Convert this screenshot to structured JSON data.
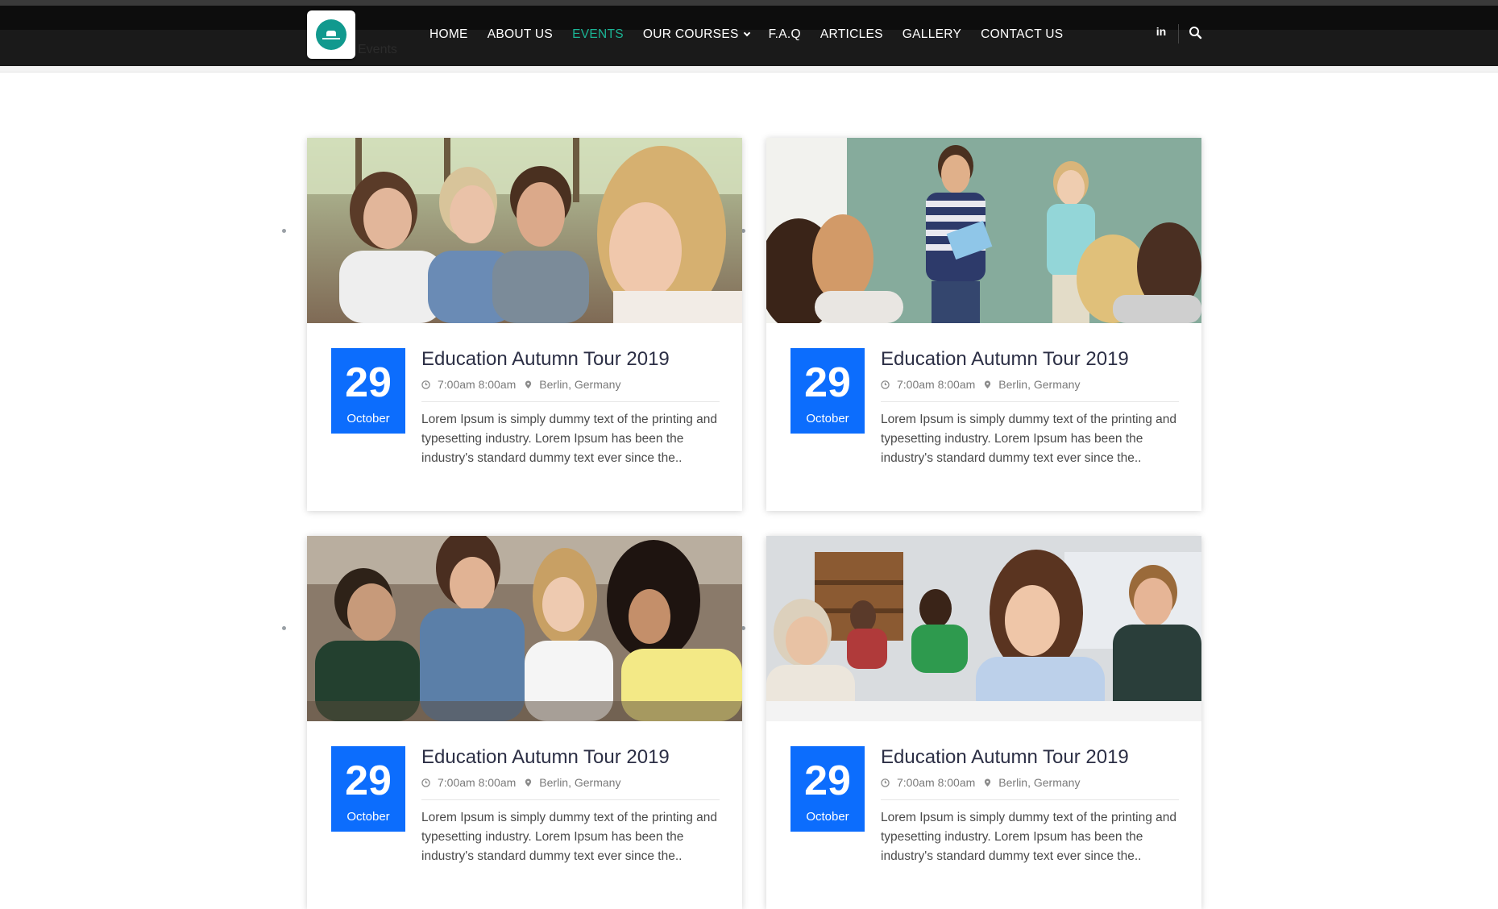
{
  "header": {
    "breadcrumb": "Events",
    "nav": [
      {
        "label": "HOME",
        "active": false
      },
      {
        "label": "ABOUT US",
        "active": false
      },
      {
        "label": "EVENTS",
        "active": true
      },
      {
        "label": "OUR COURSES",
        "active": false,
        "dropdown": true
      },
      {
        "label": "F.A.Q",
        "active": false
      },
      {
        "label": "ARTICLES",
        "active": false
      },
      {
        "label": "GALLERY",
        "active": false
      },
      {
        "label": "CONTACT US",
        "active": false
      }
    ],
    "social_label": "in",
    "accent_color": "#1ab394"
  },
  "events": [
    {
      "day": "29",
      "month": "October",
      "title": "Education Autumn Tour 2019",
      "time": "7:00am 8:00am",
      "location": "Berlin, Germany",
      "description": "Lorem Ipsum is simply dummy text of the printing and typesetting industry. Lorem Ipsum has been the industry's standard dummy text ever since the..",
      "photo": "students-studying-photo"
    },
    {
      "day": "29",
      "month": "October",
      "title": "Education Autumn Tour 2019",
      "time": "7:00am 8:00am",
      "location": "Berlin, Germany",
      "description": "Lorem Ipsum is simply dummy text of the printing and typesetting industry. Lorem Ipsum has been the industry's standard dummy text ever since the..",
      "photo": "teacher-chalkboard-photo"
    },
    {
      "day": "29",
      "month": "October",
      "title": "Education Autumn Tour 2019",
      "time": "7:00am 8:00am",
      "location": "Berlin, Germany",
      "description": "Lorem Ipsum is simply dummy text of the printing and typesetting industry. Lorem Ipsum has been the industry's standard dummy text ever since the..",
      "photo": "group-study-photo"
    },
    {
      "day": "29",
      "month": "October",
      "title": "Education Autumn Tour 2019",
      "time": "7:00am 8:00am",
      "location": "Berlin, Germany",
      "description": "Lorem Ipsum is simply dummy text of the printing and typesetting industry. Lorem Ipsum has been the industry's standard dummy text ever since the..",
      "photo": "classroom-exam-photo"
    }
  ],
  "date_box_color": "#0c6dfd"
}
